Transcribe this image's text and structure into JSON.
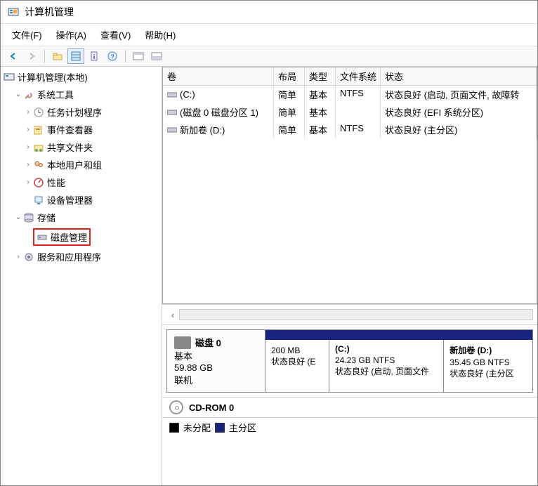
{
  "window": {
    "title": "计算机管理"
  },
  "menu": {
    "file": "文件(F)",
    "action": "操作(A)",
    "view": "查看(V)",
    "help": "帮助(H)"
  },
  "tree": {
    "root": "计算机管理(本地)",
    "system_tools": "系统工具",
    "task_scheduler": "任务计划程序",
    "event_viewer": "事件查看器",
    "shared_folders": "共享文件夹",
    "local_users": "本地用户和组",
    "performance": "性能",
    "device_manager": "设备管理器",
    "storage": "存储",
    "disk_management": "磁盘管理",
    "services_apps": "服务和应用程序"
  },
  "vol_headers": {
    "name": "卷",
    "layout": "布局",
    "type": "类型",
    "fs": "文件系统",
    "status": "状态"
  },
  "volumes": [
    {
      "name": "(C:)",
      "layout": "简单",
      "type": "基本",
      "fs": "NTFS",
      "status": "状态良好 (启动, 页面文件, 故障转"
    },
    {
      "name": "(磁盘 0 磁盘分区 1)",
      "layout": "简单",
      "type": "基本",
      "fs": "",
      "status": "状态良好 (EFI 系统分区)"
    },
    {
      "name": "新加卷 (D:)",
      "layout": "简单",
      "type": "基本",
      "fs": "NTFS",
      "status": "状态良好 (主分区)"
    }
  ],
  "disk0": {
    "title": "磁盘 0",
    "type": "基本",
    "size": "59.88 GB",
    "state": "联机",
    "p0": {
      "title": "",
      "size": "200 MB",
      "status": "状态良好 (E"
    },
    "p1": {
      "title": "(C:)",
      "size": "24.23 GB NTFS",
      "status": "状态良好 (启动, 页面文件"
    },
    "p2": {
      "title": "新加卷  (D:)",
      "size": "35.45 GB NTFS",
      "status": "状态良好 (主分区"
    }
  },
  "cdrom": {
    "label": "CD-ROM 0"
  },
  "legend": {
    "unallocated": "未分配",
    "primary": "主分区"
  },
  "colors": {
    "diskbar": "#1a237e",
    "unallocated": "#000000",
    "primary": "#1a237e"
  }
}
